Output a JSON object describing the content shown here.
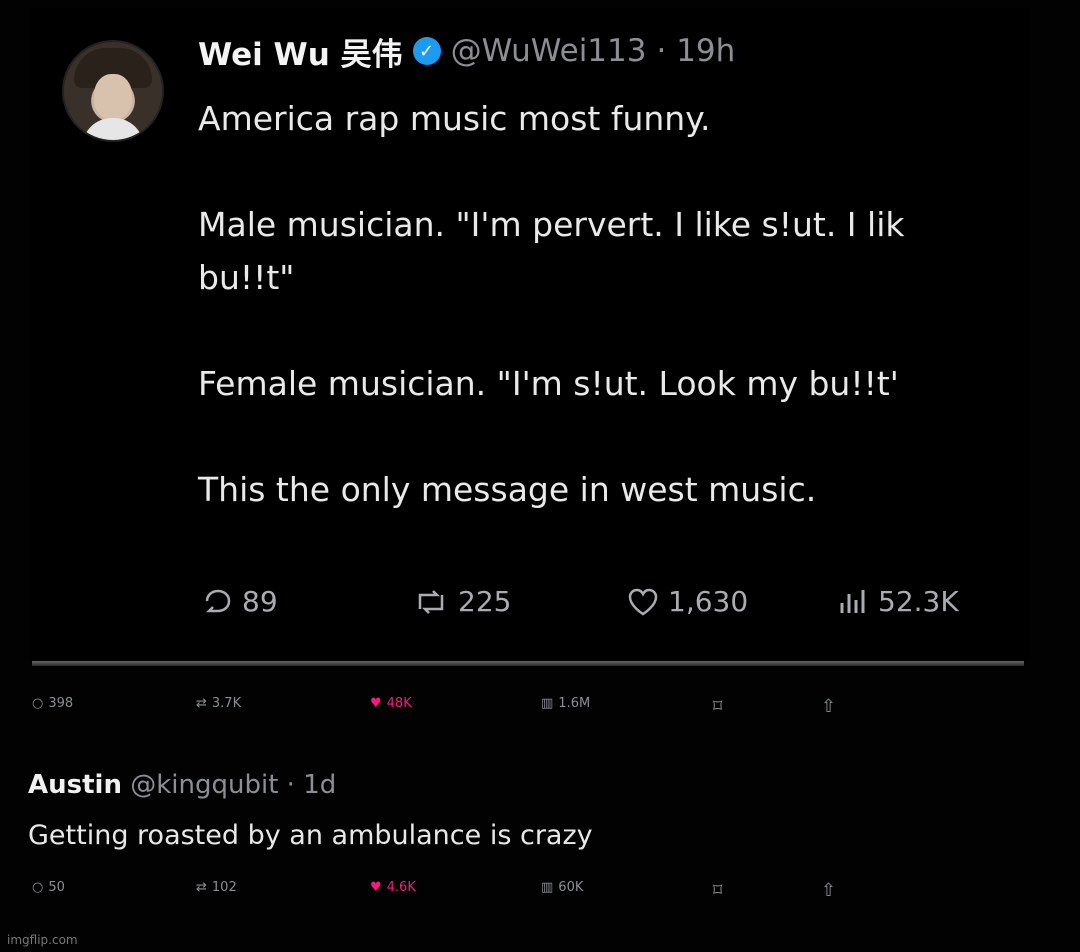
{
  "tweet": {
    "author_name": "Wei Wu 吴伟",
    "handle": "@WuWei113",
    "time": "· 19h",
    "verified_icon": "verified-check-icon",
    "line1": "America rap music most funny.",
    "line2": "Male musician. \"I'm pervert. I like s!ut. I lik",
    "line3": "bu!!t\"",
    "line4": "Female musician. \"I'm s!ut. Look my bu!!t'",
    "line5": "This the only message in west music.",
    "stats": {
      "replies": "89",
      "reposts": "225",
      "likes": "1,630",
      "views": "52.3K"
    }
  },
  "parent_actions": {
    "replies": "398",
    "reposts": "3.7K",
    "likes": "48K",
    "views": "1.6M"
  },
  "reply": {
    "name": "Austin",
    "handle": "@kingqubit",
    "time": "· 1d",
    "text": "Getting roasted by an ambulance is crazy",
    "actions": {
      "replies": "50",
      "reposts": "102",
      "likes": "4.6K",
      "views": "60K"
    }
  },
  "watermark": "imgflip.com",
  "colors": {
    "background": "#000000",
    "verified": "#1d9bf0",
    "like_pink": "#f91880",
    "muted": "#8b8f93"
  }
}
